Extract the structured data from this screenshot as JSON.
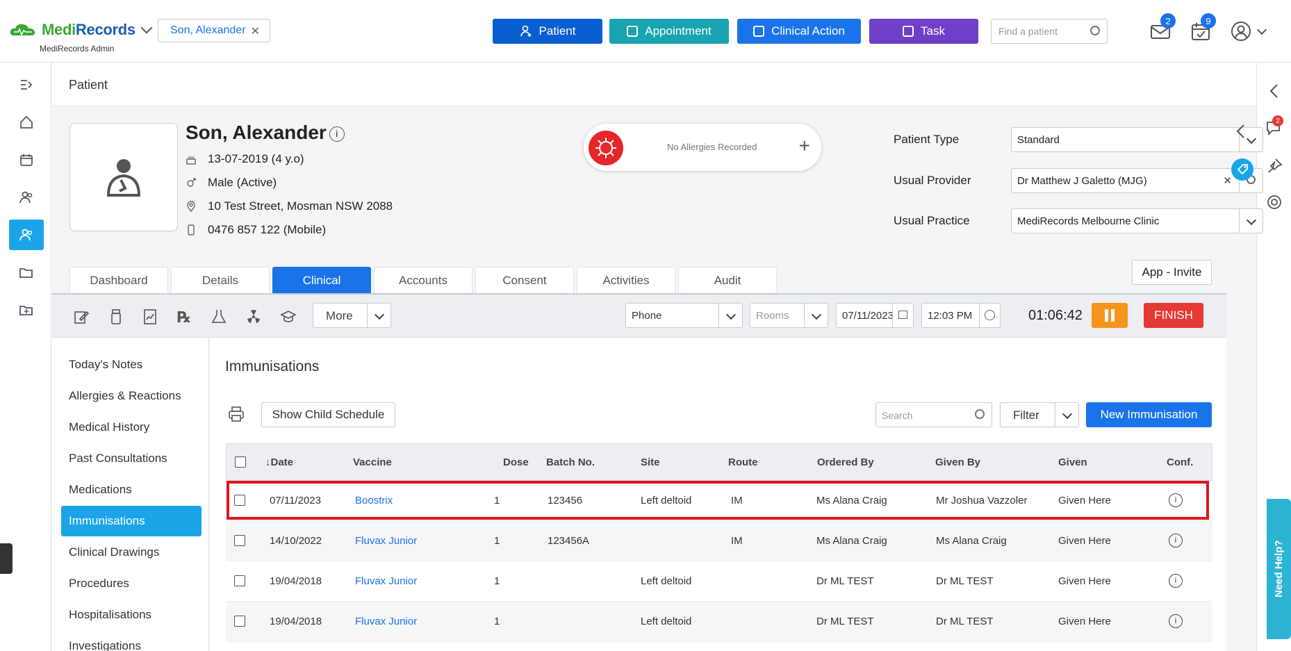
{
  "app": {
    "logo_primary": "Medi",
    "logo_secondary": "Records",
    "subtitle": "MediRecords Admin",
    "open_patient_chip": "Son, Alexander"
  },
  "top_actions": {
    "patient": "Patient",
    "appointment": "Appointment",
    "clinical_action": "Clinical Action",
    "task": "Task",
    "search_placeholder": "Find a patient",
    "mail_badge": "2",
    "tasks_badge": "9"
  },
  "page": {
    "title": "Patient"
  },
  "patient": {
    "name": "Son, Alexander",
    "dob": "13-07-2019 (4 y.o)",
    "gender": "Male (Active)",
    "address": "10 Test Street, Mosman NSW 2088",
    "phone": "0476 857 122 (Mobile)",
    "allergies": "No Allergies Recorded"
  },
  "fields": {
    "patient_type_label": "Patient Type",
    "patient_type_value": "Standard",
    "usual_provider_label": "Usual Provider",
    "usual_provider_value": "Dr Matthew J Galetto (MJG)",
    "usual_practice_label": "Usual Practice",
    "usual_practice_value": "MediRecords Melbourne Clinic",
    "app_invite": "App - Invite"
  },
  "tabs": [
    "Dashboard",
    "Details",
    "Clinical",
    "Accounts",
    "Consent",
    "Activities",
    "Audit"
  ],
  "toolbar": {
    "more": "More",
    "contact_type": "Phone",
    "rooms_placeholder": "Rooms",
    "date": "07/11/2023",
    "time": "12:03 PM",
    "timer": "01:06:42",
    "finish": "FINISH"
  },
  "clinical_nav": [
    "Today's Notes",
    "Allergies & Reactions",
    "Medical History",
    "Past Consultations",
    "Medications",
    "Immunisations",
    "Clinical Drawings",
    "Procedures",
    "Hospitalisations",
    "Investigations"
  ],
  "immunisations": {
    "title": "Immunisations",
    "show_child_schedule": "Show Child Schedule",
    "search_placeholder": "Search",
    "filter": "Filter",
    "new_button": "New Immunisation",
    "columns": [
      "↓Date",
      "Vaccine",
      "Dose",
      "Batch No.",
      "Site",
      "Route",
      "Ordered By",
      "Given By",
      "Given",
      "Conf."
    ],
    "rows": [
      {
        "date": "07/11/2023",
        "vaccine": "Boostrix",
        "dose": "1",
        "batch": "123456",
        "site": "Left deltoid",
        "route": "IM",
        "ordered_by": "Ms Alana Craig",
        "given_by": "Mr Joshua Vazzoler",
        "given": "Given Here"
      },
      {
        "date": "14/10/2022",
        "vaccine": "Fluvax Junior",
        "dose": "1",
        "batch": "123456A",
        "site": "",
        "route": "IM",
        "ordered_by": "Ms Alana Craig",
        "given_by": "Ms Alana Craig",
        "given": "Given Here"
      },
      {
        "date": "19/04/2018",
        "vaccine": "Fluvax Junior",
        "dose": "1",
        "batch": "",
        "site": "Left deltoid",
        "route": "",
        "ordered_by": "Dr ML TEST",
        "given_by": "Dr ML TEST",
        "given": "Given Here"
      },
      {
        "date": "19/04/2018",
        "vaccine": "Fluvax Junior",
        "dose": "1",
        "batch": "",
        "site": "Left deltoid",
        "route": "",
        "ordered_by": "Dr ML TEST",
        "given_by": "Dr ML TEST",
        "given": "Given Here"
      }
    ]
  },
  "right_rail": {
    "chat_badge": "2",
    "need_help": "Need Help?"
  },
  "colors": {
    "primary": "#1a73e8",
    "accent": "#1ba5e8",
    "appointment": "#1aa3b0",
    "task": "#6f3fc8",
    "finish": "#e53935",
    "pause": "#f7941d"
  }
}
